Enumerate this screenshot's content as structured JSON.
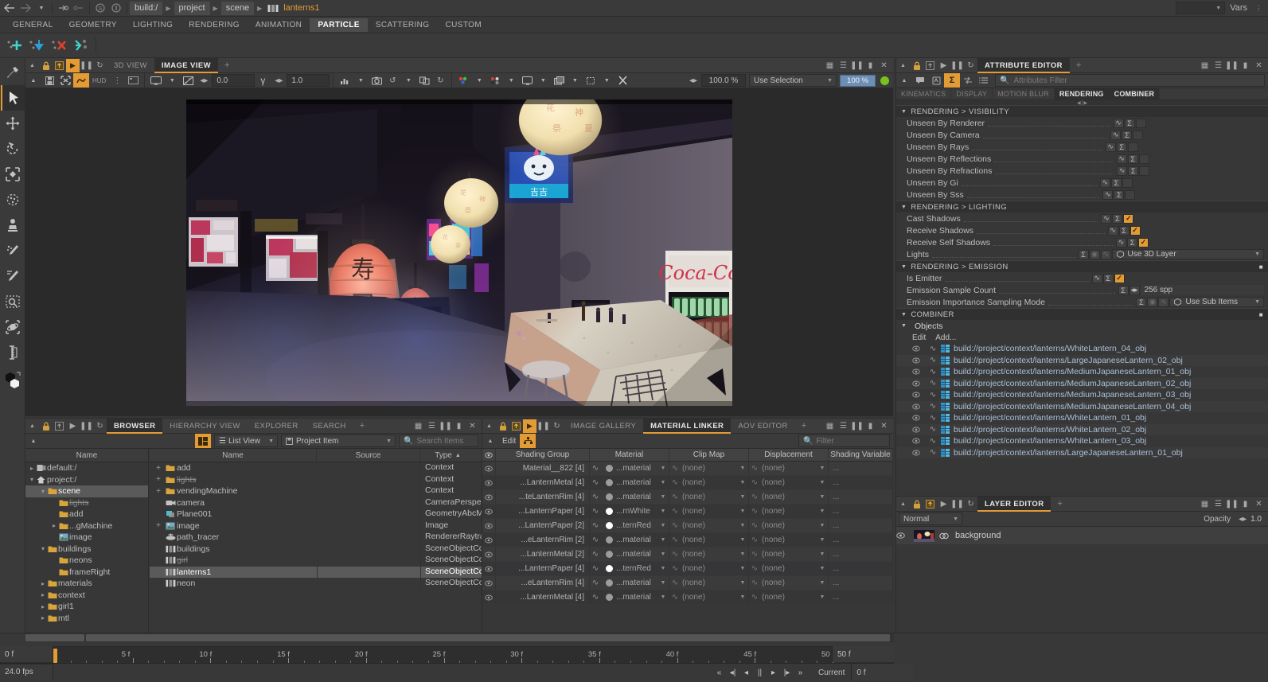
{
  "app": {
    "title": "lanterns1",
    "vars_label": "Vars"
  },
  "pathbar": {
    "crumbs": [
      "build:/",
      "project",
      "scene"
    ],
    "current": "lanterns1",
    "icons": [
      "back-arrow",
      "forward-arrow",
      "history-dropdown",
      "link-in",
      "link-out",
      "circle-s",
      "circle-i"
    ]
  },
  "menubar": {
    "items": [
      "GENERAL",
      "GEOMETRY",
      "LIGHTING",
      "RENDERING",
      "ANIMATION",
      "PARTICLE",
      "SCATTERING",
      "CUSTOM"
    ],
    "active": "PARTICLE"
  },
  "top_toolbar": {
    "icons": [
      "add-particle-icon",
      "drop-particle-icon",
      "delete-particle-icon",
      "scatter-particle-icon"
    ]
  },
  "left_tools": [
    {
      "name": "eyedropper-tool",
      "glyph": "eyedropper"
    },
    {
      "name": "select-tool",
      "glyph": "cursor",
      "selected": true
    },
    {
      "name": "move-tool",
      "glyph": "move"
    },
    {
      "name": "rotate-tool",
      "glyph": "rotate"
    },
    {
      "name": "scale-tool",
      "glyph": "scale"
    },
    {
      "name": "deform-tool",
      "glyph": "deform"
    },
    {
      "name": "stamp-tool",
      "glyph": "stamp"
    },
    {
      "name": "paint-scatter-tool",
      "glyph": "paint-scatter"
    },
    {
      "name": "brush-tool",
      "glyph": "brush"
    },
    {
      "name": "marquee-zoom-tool",
      "glyph": "marquee-zoom"
    },
    {
      "name": "orbit-tool",
      "glyph": "orbit"
    },
    {
      "name": "measure-tool",
      "glyph": "measure"
    },
    {
      "name": "color-swatch",
      "glyph": "swatch"
    }
  ],
  "viewport": {
    "tabs": [
      "3D VIEW",
      "IMAGE VIEW"
    ],
    "active_tab": "IMAGE VIEW",
    "plus": "+",
    "zoom_value": "100.0",
    "zoom_unit": "%",
    "exposure": "0.0",
    "gamma": "1.0",
    "hud_label": "HUD",
    "selection_mode": "Use Selection",
    "render_progress": "100 %",
    "lock_icons": [
      "collapse-arrow",
      "lock-icon",
      "snapshot-icon",
      "play-icon",
      "pause-icon",
      "refresh-icon"
    ],
    "layout_icons": [
      "grid-layout-icon",
      "rows-layout-icon",
      "columns-layout-icon",
      "single-layout-icon",
      "close-icon"
    ]
  },
  "browser": {
    "tabs": [
      "BROWSER",
      "HIERARCHY VIEW",
      "EXPLORER",
      "SEARCH"
    ],
    "active_tab": "BROWSER",
    "plus": "+",
    "view_mode": "List View",
    "filter_type": "Project Item",
    "search_placeholder": "Search Items",
    "tree_header": "Name",
    "tree": [
      {
        "label": "default:/",
        "depth": 0,
        "icon": "book-icon",
        "arrow": "▸"
      },
      {
        "label": "project:/",
        "depth": 0,
        "icon": "home-icon",
        "arrow": "▾"
      },
      {
        "label": "scene",
        "depth": 1,
        "icon": "folder-icon",
        "arrow": "▾",
        "selected": true
      },
      {
        "label": "lights",
        "depth": 2,
        "icon": "folder-icon",
        "arrow": "",
        "strike": true
      },
      {
        "label": "add",
        "depth": 2,
        "icon": "folder-icon",
        "arrow": ""
      },
      {
        "label": "...gMachine",
        "depth": 2,
        "icon": "folder-icon",
        "arrow": "▸"
      },
      {
        "label": "image",
        "depth": 2,
        "icon": "image-icon",
        "arrow": ""
      },
      {
        "label": "buildings",
        "depth": 1,
        "icon": "folder-icon",
        "arrow": "▾"
      },
      {
        "label": "neons",
        "depth": 2,
        "icon": "folder-icon",
        "arrow": ""
      },
      {
        "label": "frameRight",
        "depth": 2,
        "icon": "folder-icon",
        "arrow": ""
      },
      {
        "label": "materials",
        "depth": 1,
        "icon": "folder-icon",
        "arrow": "▸"
      },
      {
        "label": "context",
        "depth": 1,
        "icon": "folder-icon",
        "arrow": "▸"
      },
      {
        "label": "girl1",
        "depth": 1,
        "icon": "folder-icon",
        "arrow": "▸"
      },
      {
        "label": "mtl",
        "depth": 1,
        "icon": "folder-icon",
        "arrow": "▸"
      }
    ],
    "columns": [
      "Name",
      "Source",
      "Type"
    ],
    "items": [
      {
        "expand": "+",
        "icon": "folder-icon",
        "name": "add",
        "source": "",
        "type": "Context"
      },
      {
        "expand": "+",
        "icon": "folder-icon",
        "name": "lights",
        "source": "",
        "type": "Context",
        "strike": true
      },
      {
        "expand": "+",
        "icon": "folder-icon",
        "name": "vendingMachine",
        "source": "",
        "type": "Context"
      },
      {
        "expand": "",
        "icon": "camera-icon",
        "name": "camera",
        "source": "",
        "type": "CameraPerspectiv"
      },
      {
        "expand": "",
        "icon": "geometry-icon",
        "name": "Plane001",
        "source": "",
        "type": "GeometryAbcMes"
      },
      {
        "expand": "+",
        "icon": "image-icon",
        "name": "image",
        "source": "",
        "type": "Image"
      },
      {
        "expand": "",
        "icon": "raytracer-icon",
        "name": "path_tracer",
        "source": "",
        "type": "RendererRaytracer"
      },
      {
        "expand": "",
        "icon": "combiner-icon",
        "name": "buildings",
        "source": "",
        "type": "SceneObjectComb"
      },
      {
        "expand": "",
        "icon": "combiner-icon",
        "name": "girl",
        "source": "",
        "type": "SceneObjectComb",
        "strike": true
      },
      {
        "expand": "",
        "icon": "combiner-icon",
        "name": "lanterns1",
        "source": "",
        "type": "SceneObjectComb",
        "selected": true
      },
      {
        "expand": "",
        "icon": "combiner-icon",
        "name": "neon",
        "source": "",
        "type": "SceneObjectComb"
      }
    ]
  },
  "material_linker": {
    "tabs": [
      "IMAGE GALLERY",
      "MATERIAL LINKER",
      "AOV EDITOR"
    ],
    "active_tab": "MATERIAL LINKER",
    "plus": "+",
    "edit_label": "Edit",
    "filter_placeholder": "Filter",
    "columns": [
      "Shading Group",
      "Material",
      "Clip Map",
      "Displacement",
      "Shading Variable"
    ],
    "rows": [
      {
        "group": "Material__822 [4]",
        "material": "...material",
        "material_white": false,
        "clip": "(none)",
        "disp": "(none)",
        "shading_var": "..."
      },
      {
        "group": "...LanternMetal [4]",
        "material": "...material",
        "material_white": false,
        "clip": "(none)",
        "disp": "(none)",
        "shading_var": "..."
      },
      {
        "group": "...teLanternRim [4]",
        "material": "...material",
        "material_white": false,
        "clip": "(none)",
        "disp": "(none)",
        "shading_var": "..."
      },
      {
        "group": "...LanternPaper [4]",
        "material": "...rnWhite",
        "material_white": true,
        "clip": "(none)",
        "disp": "(none)",
        "shading_var": "..."
      },
      {
        "group": "...LanternPaper [2]",
        "material": "...ternRed",
        "material_white": true,
        "clip": "(none)",
        "disp": "(none)",
        "shading_var": "..."
      },
      {
        "group": "...eLanternRim [2]",
        "material": "...material",
        "material_white": false,
        "clip": "(none)",
        "disp": "(none)",
        "shading_var": "..."
      },
      {
        "group": "...LanternMetal [2]",
        "material": "...material",
        "material_white": false,
        "clip": "(none)",
        "disp": "(none)",
        "shading_var": "..."
      },
      {
        "group": "...LanternPaper [4]",
        "material": "...ternRed",
        "material_white": true,
        "clip": "(none)",
        "disp": "(none)",
        "shading_var": "..."
      },
      {
        "group": "...eLanternRim [4]",
        "material": "...material",
        "material_white": false,
        "clip": "(none)",
        "disp": "(none)",
        "shading_var": "..."
      },
      {
        "group": "...LanternMetal [4]",
        "material": "...material",
        "material_white": false,
        "clip": "(none)",
        "disp": "(none)",
        "shading_var": "..."
      }
    ]
  },
  "attribute_editor": {
    "tabs": [
      "ATTRIBUTE EDITOR"
    ],
    "active_tab": "ATTRIBUTE EDITOR",
    "plus": "+",
    "filter_placeholder": "Attributes Filter",
    "subtabs": [
      "KINEMATICS",
      "DISPLAY",
      "MOTION BLUR",
      "RENDERING",
      "COMBINER"
    ],
    "active_subtabs": [
      "RENDERING",
      "COMBINER"
    ],
    "sections": [
      {
        "title": "RENDERING > VISIBILITY",
        "rows": [
          {
            "label": "Unseen By Renderer",
            "checked": false
          },
          {
            "label": "Unseen By Camera",
            "checked": false
          },
          {
            "label": "Unseen By Rays",
            "checked": false
          },
          {
            "label": "Unseen By Reflections",
            "checked": false
          },
          {
            "label": "Unseen By Refractions",
            "checked": false
          },
          {
            "label": "Unseen By Gi",
            "checked": false
          },
          {
            "label": "Unseen By Sss",
            "checked": false
          }
        ]
      },
      {
        "title": "RENDERING > LIGHTING",
        "rows": [
          {
            "label": "Cast Shadows",
            "checked": true
          },
          {
            "label": "Receive Shadows",
            "checked": true
          },
          {
            "label": "Receive Self Shadows",
            "checked": true
          },
          {
            "label": "Lights",
            "type": "combo",
            "value": "Use 3D Layer"
          }
        ]
      },
      {
        "title": "RENDERING > EMISSION",
        "rows": [
          {
            "label": "Is Emitter",
            "checked": true
          },
          {
            "label": "Emission Sample Count",
            "type": "value",
            "value": "256 spp"
          },
          {
            "label": "Emission Importance Sampling Mode",
            "type": "combo",
            "value": "Use Sub Items"
          }
        ]
      }
    ],
    "combiner": {
      "title": "COMBINER",
      "objects_label": "Objects",
      "edit_label": "Edit",
      "add_label": "Add...",
      "objects": [
        "build://project/context/lanterns/WhiteLantern_04_obj",
        "build://project/context/lanterns/LargeJapaneseLantern_02_obj",
        "build://project/context/lanterns/MediumJapaneseLantern_01_obj",
        "build://project/context/lanterns/MediumJapaneseLantern_02_obj",
        "build://project/context/lanterns/MediumJapaneseLantern_03_obj",
        "build://project/context/lanterns/MediumJapaneseLantern_04_obj",
        "build://project/context/lanterns/WhiteLantern_01_obj",
        "build://project/context/lanterns/WhiteLantern_02_obj",
        "build://project/context/lanterns/WhiteLantern_03_obj",
        "build://project/context/lanterns/LargeJapaneseLantern_01_obj"
      ]
    }
  },
  "layer_editor": {
    "tabs": [
      "LAYER EDITOR"
    ],
    "active_tab": "LAYER EDITOR",
    "plus": "+",
    "blend_mode": "Normal",
    "opacity_label": "Opacity",
    "opacity_value": "1.0",
    "layers": [
      {
        "name": "background",
        "visible": true
      }
    ]
  },
  "timeline": {
    "start_frame": "0 f",
    "fps": "24.0 fps",
    "end_frame_field": "50 f",
    "current_label": "Current",
    "current_value": "0 f",
    "ticks": [
      {
        "label": "0 f",
        "frame": 0
      },
      {
        "label": "5 f",
        "frame": 5
      },
      {
        "label": "10 f",
        "frame": 10
      },
      {
        "label": "15 f",
        "frame": 15
      },
      {
        "label": "20 f",
        "frame": 20
      },
      {
        "label": "25 f",
        "frame": 25
      },
      {
        "label": "30 f",
        "frame": 30
      },
      {
        "label": "35 f",
        "frame": 35
      },
      {
        "label": "40 f",
        "frame": 40
      },
      {
        "label": "45 f",
        "frame": 45
      },
      {
        "label": "50 f",
        "frame": 50
      }
    ],
    "playhead_frame": 0,
    "transport": [
      "«",
      "◂|",
      "◂",
      "||",
      "▸",
      "|▸",
      "»"
    ]
  },
  "colors": {
    "accent": "#e39b36",
    "panel_bg": "#373737",
    "header_bg": "#3a3a3a",
    "text": "#c8c8c8",
    "link_blue": "#a9c0d8",
    "selection": "#5a5a5a"
  }
}
